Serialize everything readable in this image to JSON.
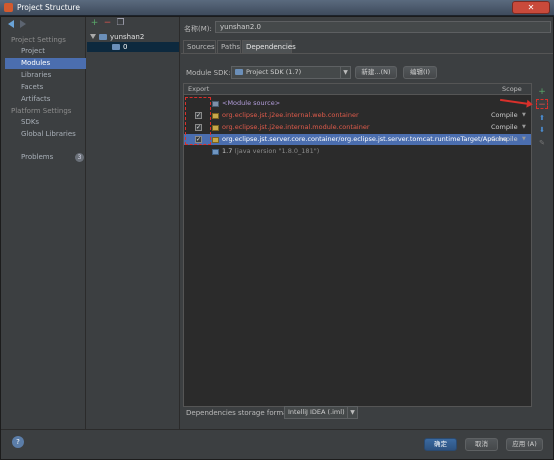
{
  "window": {
    "title": "Project Structure"
  },
  "left": {
    "project_settings_label": "Project Settings",
    "project_settings_items": [
      "Project",
      "Modules",
      "Libraries",
      "Facets",
      "Artifacts"
    ],
    "platform_settings_label": "Platform Settings",
    "platform_settings_items": [
      "SDKs",
      "Global Libraries"
    ],
    "problems_label": "Problems",
    "problems_count": "3"
  },
  "tree": {
    "add_symbol": "+",
    "remove_symbol": "−",
    "root_label": "yunshan2",
    "child_label": "0"
  },
  "module": {
    "name_label": "名称(M):",
    "name_value": "yunshan2.0",
    "tabs": [
      "Sources",
      "Paths",
      "Dependencies"
    ],
    "sdk_label": "Module SDK:",
    "sdk_value": "Project SDK (1.7)",
    "new_button": "新建...(N)",
    "edit_button": "编辑(I)"
  },
  "table": {
    "export_header": "Export",
    "scope_header": "Scope",
    "rows": [
      {
        "name": "<Module source>",
        "scope": ""
      },
      {
        "name": "org.eclipse.jst.j2ee.internal.web.container",
        "scope": "Compile",
        "checked": "✓"
      },
      {
        "name": "org.eclipse.jst.j2ee.internal.module.container",
        "scope": "Compile",
        "checked": "✓"
      },
      {
        "name": "org.eclipse.jst.server.core.container/org.eclipse.jst.server.tomcat.runtimeTarget/Apache",
        "scope": "Compile",
        "checked": "✓"
      },
      {
        "name": "1.7",
        "note": "(java version \"1.8.0_181\")",
        "scope": ""
      }
    ]
  },
  "side_buttons": {
    "add": "+",
    "remove": "−",
    "up": "⬆",
    "down": "⬇",
    "edit": "✎"
  },
  "storage": {
    "label": "Dependencies storage format:",
    "value": "IntelliJ IDEA (.iml)"
  },
  "footer": {
    "help": "?",
    "ok": "确定",
    "cancel": "取消",
    "apply": "应用 (A)"
  },
  "colors": {
    "selection": "#4b6eaf",
    "library_red": "#e05b4b",
    "annotation_red": "#d9302b",
    "primary_button": "#3b6aa0"
  }
}
